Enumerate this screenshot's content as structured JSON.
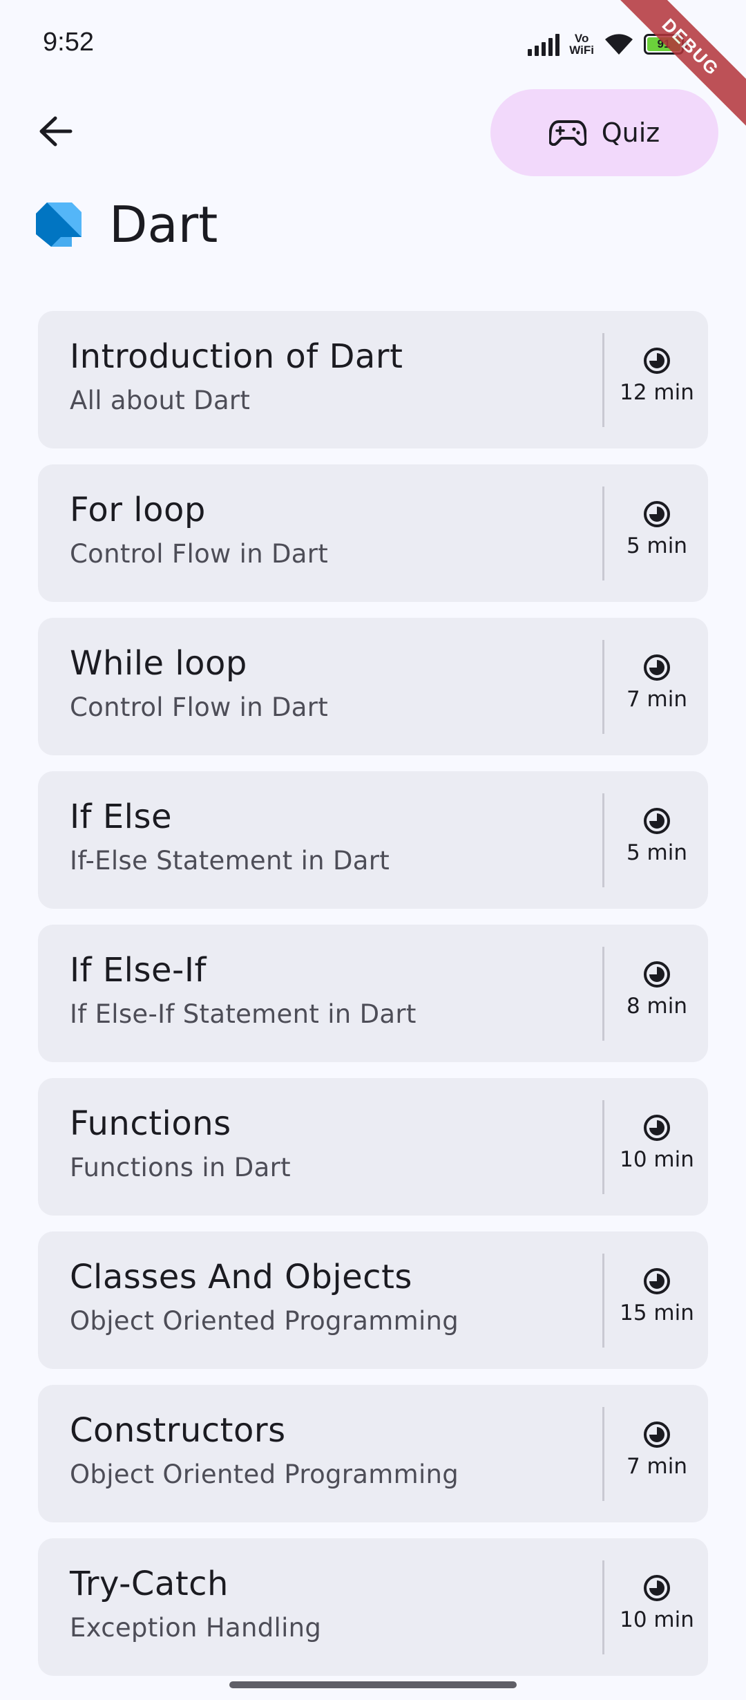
{
  "status_bar": {
    "time": "9:52",
    "vowifi_top": "Vo",
    "vowifi_bottom": "WiFi",
    "battery": "91",
    "debug_banner": "DEBUG"
  },
  "header": {
    "back_icon": "arrow-left-icon",
    "quiz_label": "Quiz",
    "quiz_icon": "gamepad-icon"
  },
  "page": {
    "title": "Dart",
    "logo_icon": "dart-logo-icon"
  },
  "lessons": [
    {
      "title": "Introduction of Dart",
      "subtitle": "All about Dart",
      "duration": "12 min"
    },
    {
      "title": "For loop",
      "subtitle": "Control Flow in Dart",
      "duration": "5 min"
    },
    {
      "title": "While loop",
      "subtitle": "Control Flow in Dart",
      "duration": "7 min"
    },
    {
      "title": "If Else",
      "subtitle": "If-Else Statement in Dart",
      "duration": "5 min"
    },
    {
      "title": "If Else-If",
      "subtitle": "If Else-If Statement in Dart",
      "duration": "8 min"
    },
    {
      "title": "Functions",
      "subtitle": "Functions in Dart",
      "duration": "10 min"
    },
    {
      "title": "Classes And Objects",
      "subtitle": "Object Oriented Programming",
      "duration": "15 min"
    },
    {
      "title": "Constructors",
      "subtitle": "Object Oriented Programming",
      "duration": "7 min"
    },
    {
      "title": "Try-Catch",
      "subtitle": "Exception Handling",
      "duration": "10 min"
    }
  ],
  "colors": {
    "background": "#f8f9ff",
    "card": "#ebecf3",
    "quiz_button": "#f2d9fb",
    "battery": "#6bd13b",
    "debug_ribbon": "#b3343a",
    "dart_logo_dark": "#0175c2",
    "dart_logo_light": "#54b6f8"
  }
}
